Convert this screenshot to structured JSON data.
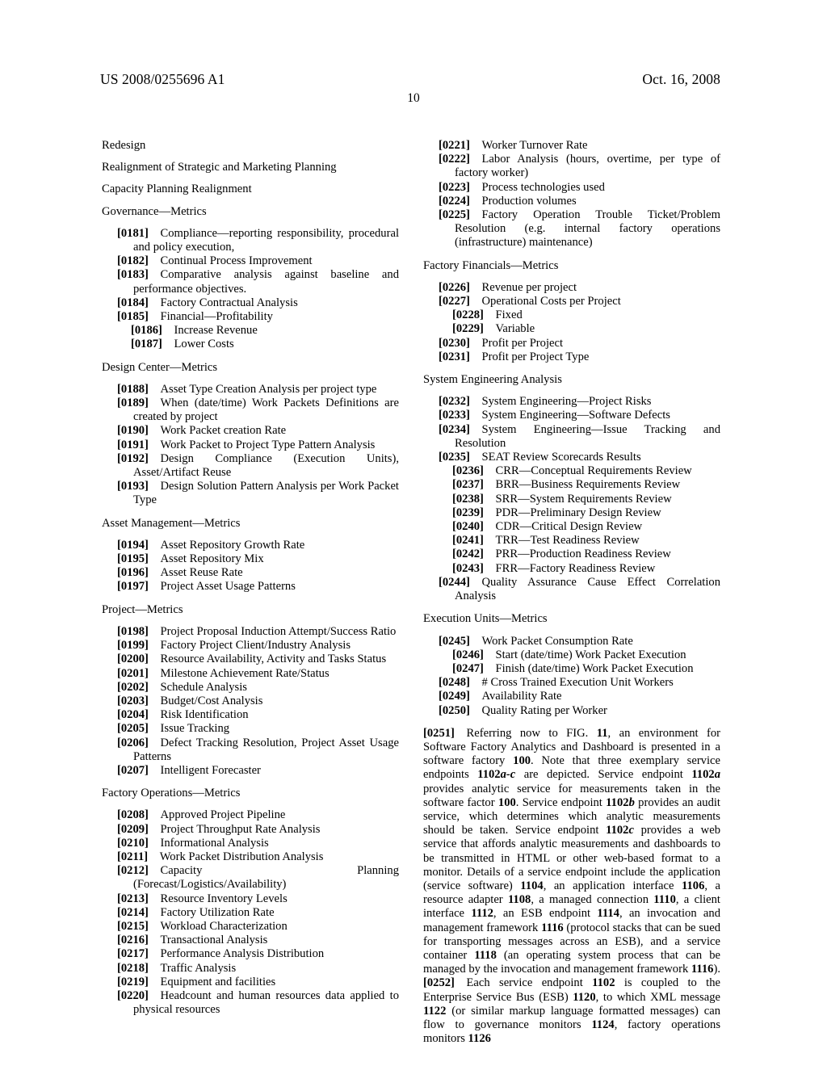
{
  "header": {
    "publication_number": "US 2008/0255696 A1",
    "publication_date": "Oct. 16, 2008",
    "page_number": "10"
  },
  "left_column": {
    "standalone_headings": [
      "Redesign",
      "Realignment of Strategic and Marketing Planning",
      "Capacity Planning Realignment"
    ],
    "sections": [
      {
        "heading": "Governance—Metrics",
        "items": [
          {
            "num": "[0181]",
            "text": "Compliance—reporting responsibility, procedural and policy execution,",
            "level": 1
          },
          {
            "num": "[0182]",
            "text": "Continual Process Improvement",
            "level": 1
          },
          {
            "num": "[0183]",
            "text": "Comparative analysis against baseline and performance objectives.",
            "level": 1
          },
          {
            "num": "[0184]",
            "text": "Factory Contractual Analysis",
            "level": 1
          },
          {
            "num": "[0185]",
            "text": "Financial—Profitability",
            "level": 1
          },
          {
            "num": "[0186]",
            "text": "Increase Revenue",
            "level": 2
          },
          {
            "num": "[0187]",
            "text": "Lower Costs",
            "level": 2
          }
        ]
      },
      {
        "heading": "Design Center—Metrics",
        "items": [
          {
            "num": "[0188]",
            "text": "Asset Type Creation Analysis per project type",
            "level": 1
          },
          {
            "num": "[0189]",
            "text": "When (date/time) Work Packets Definitions are created by project",
            "level": 1
          },
          {
            "num": "[0190]",
            "text": "Work Packet creation Rate",
            "level": 1
          },
          {
            "num": "[0191]",
            "text": "Work Packet to Project Type Pattern Analysis",
            "level": 1
          },
          {
            "num": "[0192]",
            "text": "Design Compliance (Execution Units), Asset/Artifact Reuse",
            "level": 1
          },
          {
            "num": "[0193]",
            "text": "Design Solution Pattern Analysis per Work Packet Type",
            "level": 1
          }
        ]
      },
      {
        "heading": "Asset Management—Metrics",
        "items": [
          {
            "num": "[0194]",
            "text": "Asset Repository Growth Rate",
            "level": 1
          },
          {
            "num": "[0195]",
            "text": "Asset Repository Mix",
            "level": 1
          },
          {
            "num": "[0196]",
            "text": "Asset Reuse Rate",
            "level": 1
          },
          {
            "num": "[0197]",
            "text": "Project Asset Usage Patterns",
            "level": 1
          }
        ]
      },
      {
        "heading": "Project—Metrics",
        "items": [
          {
            "num": "[0198]",
            "text": "Project Proposal Induction Attempt/Success Ratio",
            "level": 1
          },
          {
            "num": "[0199]",
            "text": "Factory Project Client/Industry Analysis",
            "level": 1
          },
          {
            "num": "[0200]",
            "text": "Resource Availability, Activity and Tasks Status",
            "level": 1
          },
          {
            "num": "[0201]",
            "text": "Milestone Achievement Rate/Status",
            "level": 1
          },
          {
            "num": "[0202]",
            "text": "Schedule Analysis",
            "level": 1
          },
          {
            "num": "[0203]",
            "text": "Budget/Cost Analysis",
            "level": 1
          },
          {
            "num": "[0204]",
            "text": "Risk Identification",
            "level": 1
          },
          {
            "num": "[0205]",
            "text": "Issue Tracking",
            "level": 1
          },
          {
            "num": "[0206]",
            "text": "Defect Tracking Resolution, Project Asset Usage Patterns",
            "level": 1
          },
          {
            "num": "[0207]",
            "text": "Intelligent Forecaster",
            "level": 1
          }
        ]
      },
      {
        "heading": "Factory Operations—Metrics",
        "items": [
          {
            "num": "[0208]",
            "text": "Approved Project Pipeline",
            "level": 1
          },
          {
            "num": "[0209]",
            "text": "Project Throughput Rate Analysis",
            "level": 1
          },
          {
            "num": "[0210]",
            "text": "Informational Analysis",
            "level": 1
          },
          {
            "num": "[0211]",
            "text": "Work Packet Distribution Analysis",
            "level": 1
          },
          {
            "num": "[0212]",
            "text": "Capacity Planning (Forecast/Logistics/Availability)",
            "level": 1
          },
          {
            "num": "[0213]",
            "text": "Resource Inventory Levels",
            "level": 1
          },
          {
            "num": "[0214]",
            "text": "Factory Utilization Rate",
            "level": 1
          },
          {
            "num": "[0215]",
            "text": "Workload Characterization",
            "level": 1
          },
          {
            "num": "[0216]",
            "text": "Transactional Analysis",
            "level": 1
          },
          {
            "num": "[0217]",
            "text": "Performance Analysis Distribution",
            "level": 1
          },
          {
            "num": "[0218]",
            "text": "Traffic Analysis",
            "level": 1
          },
          {
            "num": "[0219]",
            "text": "Equipment and facilities",
            "level": 1
          },
          {
            "num": "[0220]",
            "text": "Headcount and human resources data applied to physical resources",
            "level": 1
          }
        ]
      }
    ]
  },
  "right_column": {
    "leading_items": [
      {
        "num": "[0221]",
        "text": "Worker Turnover Rate",
        "level": 1
      },
      {
        "num": "[0222]",
        "text": "Labor Analysis (hours, overtime, per type of factory worker)",
        "level": 1
      },
      {
        "num": "[0223]",
        "text": "Process technologies used",
        "level": 1
      },
      {
        "num": "[0224]",
        "text": "Production volumes",
        "level": 1
      },
      {
        "num": "[0225]",
        "text": "Factory Operation Trouble Ticket/Problem Resolution (e.g. internal factory operations (infrastructure) maintenance)",
        "level": 1
      }
    ],
    "sections": [
      {
        "heading": "Factory Financials—Metrics",
        "items": [
          {
            "num": "[0226]",
            "text": "Revenue per project",
            "level": 1
          },
          {
            "num": "[0227]",
            "text": "Operational Costs per Project",
            "level": 1
          },
          {
            "num": "[0228]",
            "text": "Fixed",
            "level": 2
          },
          {
            "num": "[0229]",
            "text": "Variable",
            "level": 2
          },
          {
            "num": "[0230]",
            "text": "Profit per Project",
            "level": 1
          },
          {
            "num": "[0231]",
            "text": "Profit per Project Type",
            "level": 1
          }
        ]
      },
      {
        "heading": "System Engineering Analysis",
        "items": [
          {
            "num": "[0232]",
            "text": "System Engineering—Project Risks",
            "level": 1
          },
          {
            "num": "[0233]",
            "text": "System Engineering—Software Defects",
            "level": 1
          },
          {
            "num": "[0234]",
            "text": "System Engineering—Issue Tracking and Resolution",
            "level": 1
          },
          {
            "num": "[0235]",
            "text": "SEAT Review Scorecards Results",
            "level": 1
          },
          {
            "num": "[0236]",
            "text": "CRR—Conceptual Requirements Review",
            "level": 2
          },
          {
            "num": "[0237]",
            "text": "BRR—Business Requirements Review",
            "level": 2
          },
          {
            "num": "[0238]",
            "text": "SRR—System Requirements Review",
            "level": 2
          },
          {
            "num": "[0239]",
            "text": "PDR—Preliminary Design Review",
            "level": 2
          },
          {
            "num": "[0240]",
            "text": "CDR—Critical Design Review",
            "level": 2
          },
          {
            "num": "[0241]",
            "text": "TRR—Test Readiness Review",
            "level": 2
          },
          {
            "num": "[0242]",
            "text": "PRR—Production Readiness Review",
            "level": 2
          },
          {
            "num": "[0243]",
            "text": "FRR—Factory Readiness Review",
            "level": 2
          },
          {
            "num": "[0244]",
            "text": "Quality Assurance Cause Effect Correlation Analysis",
            "level": 1
          }
        ]
      },
      {
        "heading": "Execution Units—Metrics",
        "items": [
          {
            "num": "[0245]",
            "text": "Work Packet Consumption Rate",
            "level": 1
          },
          {
            "num": "[0246]",
            "text": "Start (date/time) Work Packet Execution",
            "level": 2
          },
          {
            "num": "[0247]",
            "text": "Finish (date/time) Work Packet Execution",
            "level": 2
          },
          {
            "num": "[0248]",
            "text": "# Cross Trained Execution Unit Workers",
            "level": 1
          },
          {
            "num": "[0249]",
            "text": "Availability Rate",
            "level": 1
          },
          {
            "num": "[0250]",
            "text": "Quality Rating per Worker",
            "level": 1
          }
        ]
      }
    ],
    "paragraphs": [
      {
        "num": "[0251]",
        "text": "Referring now to FIG. 11, an environment for Software Factory Analytics and Dashboard is presented in a software factory 100. Note that three exemplary service endpoints 1102a-c are depicted. Service endpoint 1102a provides analytic service for measurements taken in the software factor 100. Service endpoint 1102b provides an audit service, which determines which analytic measurements should be taken. Service endpoint 1102c provides a web service that affords analytic measurements and dashboards to be transmitted in HTML or other web-based format to a monitor. Details of a service endpoint include the application (service software) 1104, an application interface 1106, a resource adapter 1108, a managed connection 1110, a client interface 1112, an ESB endpoint 1114, an invocation and management framework 1116 (protocol stacks that can be sued for transporting messages across an ESB), and a service container 1118 (an operating system process that can be managed by the invocation and management framework 1116)."
      },
      {
        "num": "[0252]",
        "text": "Each service endpoint 1102 is coupled to the Enterprise Service Bus (ESB) 1120, to which XML message 1122 (or similar markup language formatted messages) can flow to governance monitors 1124, factory operations monitors 1126"
      }
    ]
  }
}
